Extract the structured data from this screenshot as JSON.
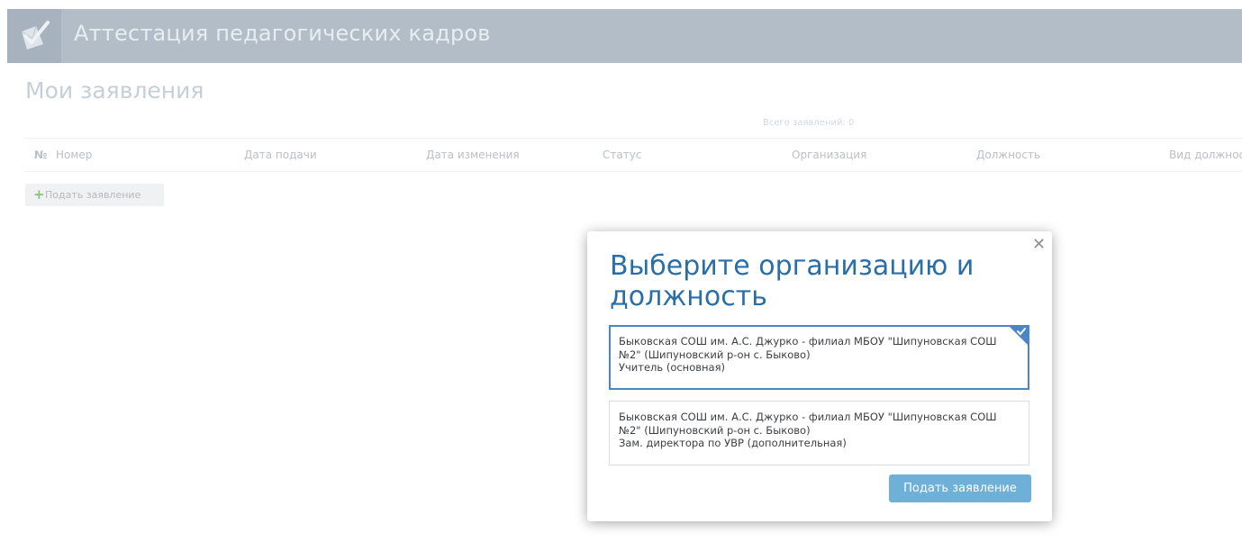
{
  "header": {
    "app_title": "Аттестация педагогических кадров",
    "logo_icon": "checkbox-envelope-icon"
  },
  "page": {
    "title": "Мои заявления",
    "total_label": "Всего заявлений: 0"
  },
  "table": {
    "columns": [
      "№",
      "Номер",
      "Дата подачи",
      "Дата изменения",
      "Статус",
      "Организация",
      "Должность",
      "Вид должнос"
    ],
    "rows": []
  },
  "actions": {
    "add_label": "Подать заявление",
    "add_icon": "plus-icon"
  },
  "modal": {
    "title": "Выберите организацию и должность",
    "close_icon": "close-icon",
    "options": [
      {
        "line1": "Быковская СОШ им. А.С. Джурко - филиал МБОУ \"Шипуновская СОШ",
        "line2": "№2\" (Шипуновский р-он с. Быково)",
        "line3": "Учитель (основная)",
        "selected": true
      },
      {
        "line1": "Быковская СОШ им. А.С. Джурко - филиал МБОУ \"Шипуновская СОШ",
        "line2": "№2\" (Шипуновский р-он с. Быково)",
        "line3": "Зам. директора по УВР (дополнительная)",
        "selected": false
      }
    ],
    "submit_label": "Подать заявление"
  },
  "colors": {
    "header_bg": "#b2bdc7",
    "accent": "#2a6ea8",
    "selected_border": "#4a86c5",
    "submit_bg": "#6fb0d8",
    "plus_green": "#8cc17a"
  }
}
